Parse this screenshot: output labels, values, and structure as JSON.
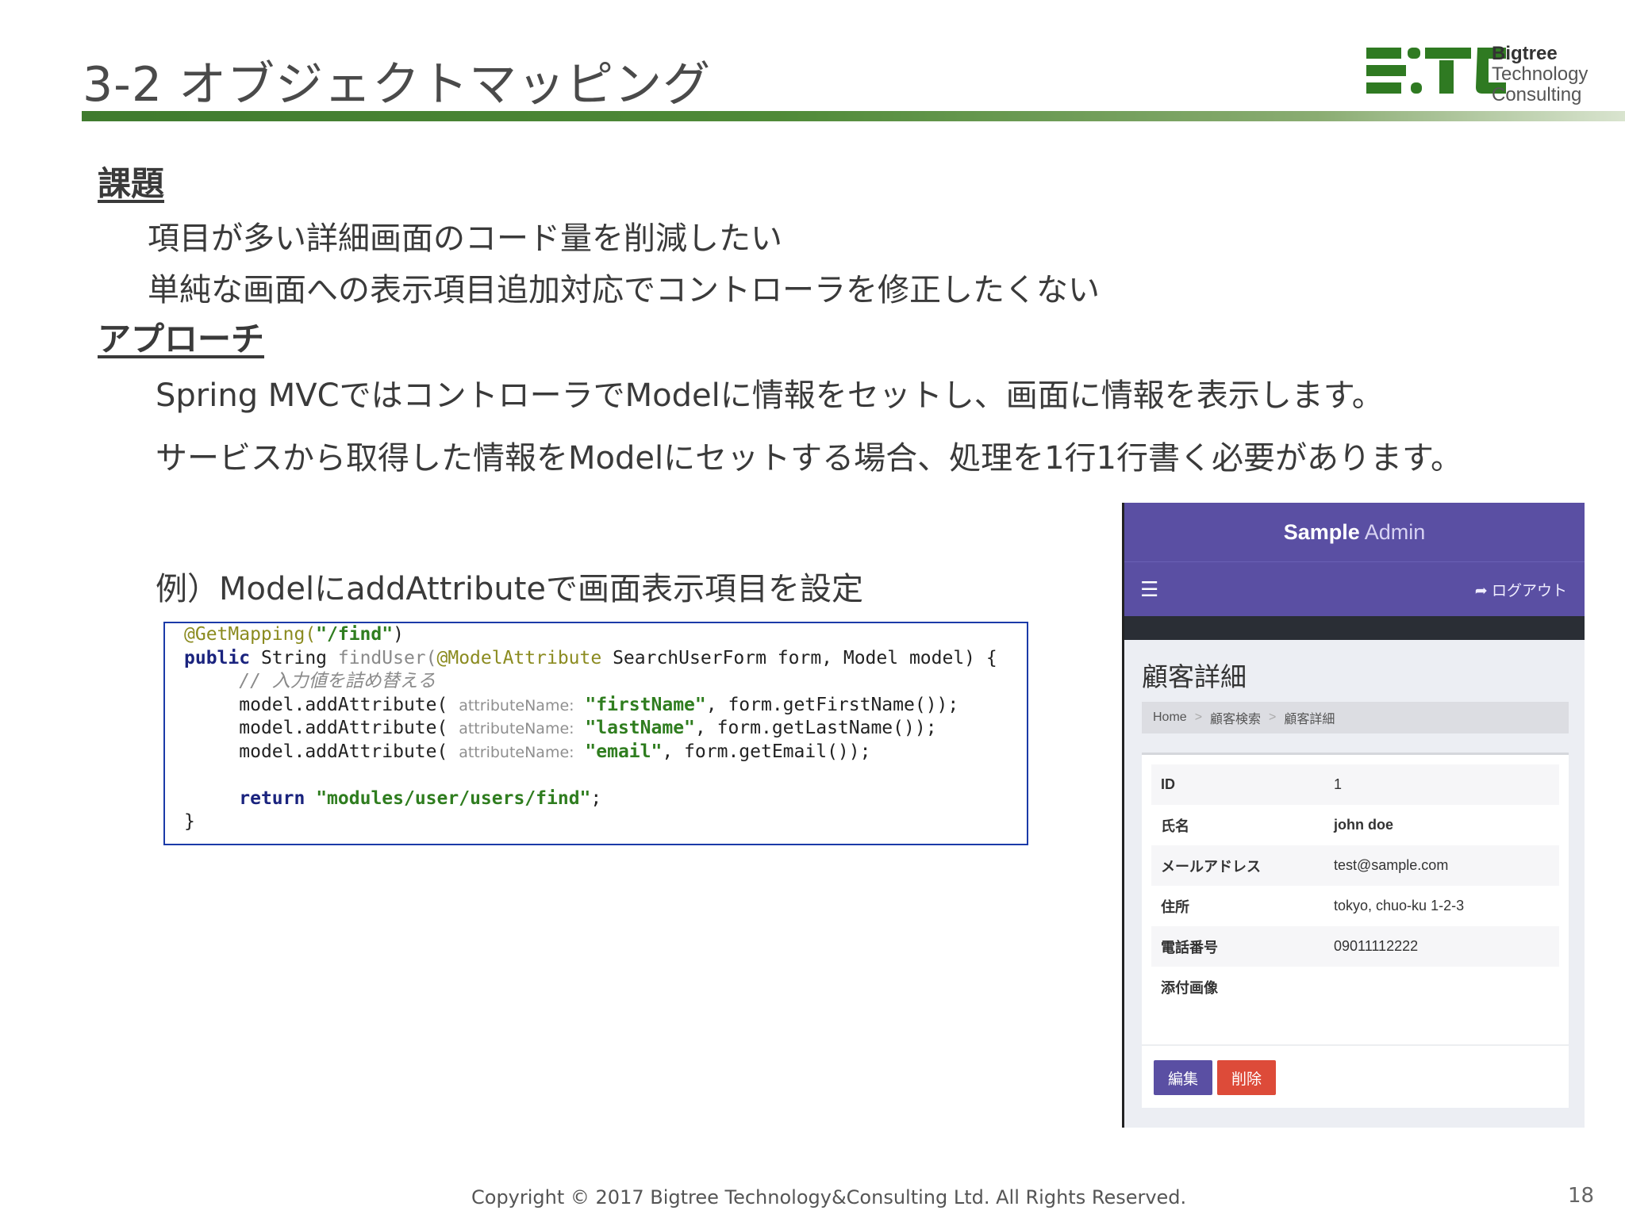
{
  "slide": {
    "title": "3-2 オブジェクトマッピング",
    "page_number": "18",
    "footer": "Copyright © 2017 Bigtree Technology&Consulting Ltd. All Rights Reserved."
  },
  "logo": {
    "line1": "Bigtree",
    "line2": "Technology",
    "line3": "Consulting",
    "colors": {
      "green": "#2f7a22"
    }
  },
  "issue": {
    "heading": "課題",
    "lines": [
      "項目が多い詳細画面のコード量を削減したい",
      "単純な画面への表示項目追加対応でコントローラを修正したくない"
    ]
  },
  "approach": {
    "heading": "アプローチ",
    "lines": [
      "Spring MVCではコントローラでModelに情報をセットし、画面に情報を表示します。",
      "サービスから取得した情報をModelにセットする場合、処理を1行1行書く必要があります。"
    ]
  },
  "example": {
    "caption": "例）ModelにaddAttributeで画面表示項目を設定",
    "code": {
      "l1_ann": "@GetMapping(",
      "l1_str": "\"/find\"",
      "l1_end": ")",
      "l2_kw": "public",
      "l2_type": " String ",
      "l2_fn": "findUser(",
      "l2_ann": "@ModelAttribute",
      "l2_rest": " SearchUserForm form, Model model) {",
      "l3_cmt": "// 入力値を詰め替える",
      "call": "model.addAttribute(",
      "hint": "attributeName:",
      "l4_str": "\"firstName\"",
      "l4_rest": ", form.getFirstName());",
      "l5_str": "\"lastName\"",
      "l5_rest": ", form.getLastName());",
      "l6_str": "\"email\"",
      "l6_rest": ", form.getEmail());",
      "l8_kw": "return",
      "l8_str": "\"modules/user/users/find\"",
      "l8_end": ";",
      "l9": "}"
    }
  },
  "admin": {
    "brand_bold": "Sample",
    "brand_light": "Admin",
    "menu_icon": "☰",
    "logout": "ログアウト",
    "logout_icon": "➦",
    "page_title": "顧客詳細",
    "breadcrumb": [
      "Home",
      "顧客検索",
      "顧客詳細"
    ],
    "breadcrumb_sep": ">",
    "rows": [
      {
        "label": "ID",
        "value": "1"
      },
      {
        "label": "氏名",
        "value": "john doe"
      },
      {
        "label": "メールアドレス",
        "value": "test@sample.com"
      },
      {
        "label": "住所",
        "value": "tokyo, chuo-ku 1-2-3"
      },
      {
        "label": "電話番号",
        "value": "09011112222"
      },
      {
        "label": "添付画像",
        "value": ""
      }
    ],
    "edit_button": "編集",
    "delete_button": "削除",
    "colors": {
      "header": "#5a4fa3",
      "delete": "#dd4b39"
    }
  }
}
